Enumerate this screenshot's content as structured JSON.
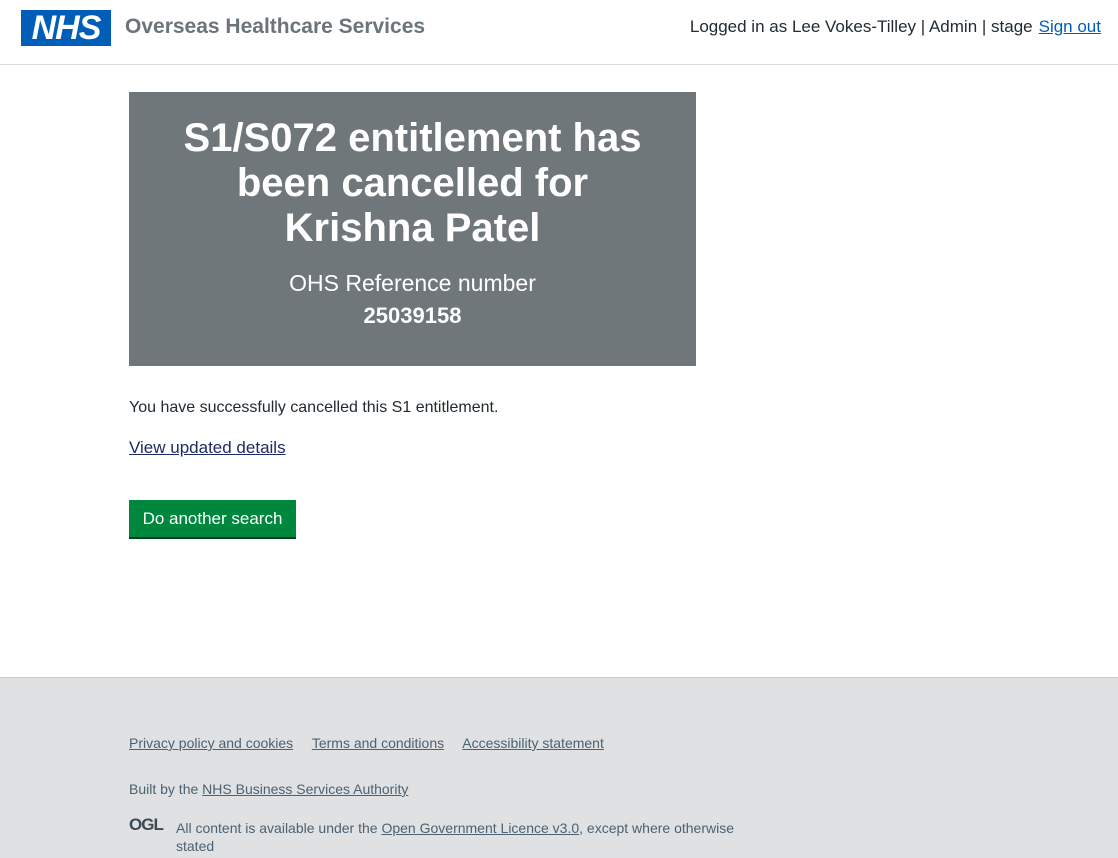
{
  "header": {
    "logo_text": "NHS",
    "service_name": "Overseas Healthcare Services",
    "account_text": "Logged in as Lee Vokes-Tilley | Admin | stage",
    "sign_out": "Sign out"
  },
  "panel": {
    "title": "S1/S072 entitlement has been cancelled for Krishna Patel",
    "ref_label": "OHS Reference number",
    "ref_number": "25039158"
  },
  "main": {
    "message": "You have successfully cancelled this S1 entitlement.",
    "details_link": "View updated details",
    "search_button": "Do another search"
  },
  "footer": {
    "links": [
      "Privacy policy and cookies",
      "Terms and conditions",
      "Accessibility statement"
    ],
    "built_prefix": "Built by the",
    "built_link": "NHS Business Services Authority",
    "ogl_logo": "OGL",
    "licence_prefix": "All content is available under the",
    "licence_link": "Open Government Licence v3.0",
    "licence_suffix": ", except where otherwise stated"
  },
  "colors": {
    "nhs_blue": "#005eb8",
    "panel_grey": "#6f777b",
    "button_green": "#00873e",
    "footer_bg": "#dfe1e3"
  }
}
